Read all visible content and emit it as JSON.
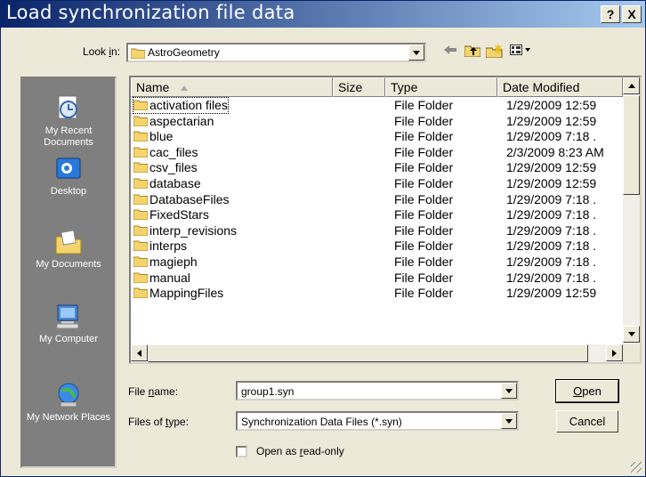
{
  "window": {
    "title": "Load synchronization file data",
    "help_button": "?",
    "close_button": "X"
  },
  "lookin": {
    "label_pre": "Look ",
    "label_ul": "i",
    "label_post": "n:",
    "value": "AstroGeometry"
  },
  "places": [
    {
      "label": "My Recent Documents",
      "icon": "recent-documents-icon"
    },
    {
      "label": "Desktop",
      "icon": "desktop-icon"
    },
    {
      "label": "My Documents",
      "icon": "my-documents-icon"
    },
    {
      "label": "My Computer",
      "icon": "my-computer-icon"
    },
    {
      "label": "My Network Places",
      "icon": "network-places-icon"
    }
  ],
  "columns": {
    "name": "Name",
    "size": "Size",
    "type": "Type",
    "date": "Date Modified"
  },
  "files": [
    {
      "name": "activation files",
      "type": "File Folder",
      "date": "1/29/2009 12:59"
    },
    {
      "name": "aspectarian",
      "type": "File Folder",
      "date": "1/29/2009 12:59"
    },
    {
      "name": "blue",
      "type": "File Folder",
      "date": "1/29/2009 7:18 ."
    },
    {
      "name": "cac_files",
      "type": "File Folder",
      "date": "2/3/2009 8:23 AM"
    },
    {
      "name": "csv_files",
      "type": "File Folder",
      "date": "1/29/2009 12:59"
    },
    {
      "name": "database",
      "type": "File Folder",
      "date": "1/29/2009 12:59"
    },
    {
      "name": "DatabaseFiles",
      "type": "File Folder",
      "date": "1/29/2009 7:18 ."
    },
    {
      "name": "FixedStars",
      "type": "File Folder",
      "date": "1/29/2009 7:18 ."
    },
    {
      "name": "interp_revisions",
      "type": "File Folder",
      "date": "1/29/2009 7:18 ."
    },
    {
      "name": "interps",
      "type": "File Folder",
      "date": "1/29/2009 7:18 ."
    },
    {
      "name": "magieph",
      "type": "File Folder",
      "date": "1/29/2009 7:18 ."
    },
    {
      "name": "manual",
      "type": "File Folder",
      "date": "1/29/2009 7:18 ."
    },
    {
      "name": "MappingFiles",
      "type": "File Folder",
      "date": "1/29/2009 12:59"
    }
  ],
  "filename": {
    "label_pre": "File ",
    "label_ul": "n",
    "label_post": "ame:",
    "value": "group1.syn"
  },
  "filetype": {
    "label_pre": "Files of ",
    "label_ul": "t",
    "label_post": "ype:",
    "value": "Synchronization Data Files (*.syn)"
  },
  "readonly": {
    "label_pre": "Open as ",
    "label_ul": "r",
    "label_post": "ead-only",
    "checked": false
  },
  "buttons": {
    "open_ul": "O",
    "open_rest": "pen",
    "cancel": "Cancel"
  },
  "colors": {
    "title_start": "#0a246a",
    "title_end": "#a6caf0",
    "sidebar": "#7f7f7f",
    "face": "#ece9d8",
    "folder": "#f5d470"
  }
}
